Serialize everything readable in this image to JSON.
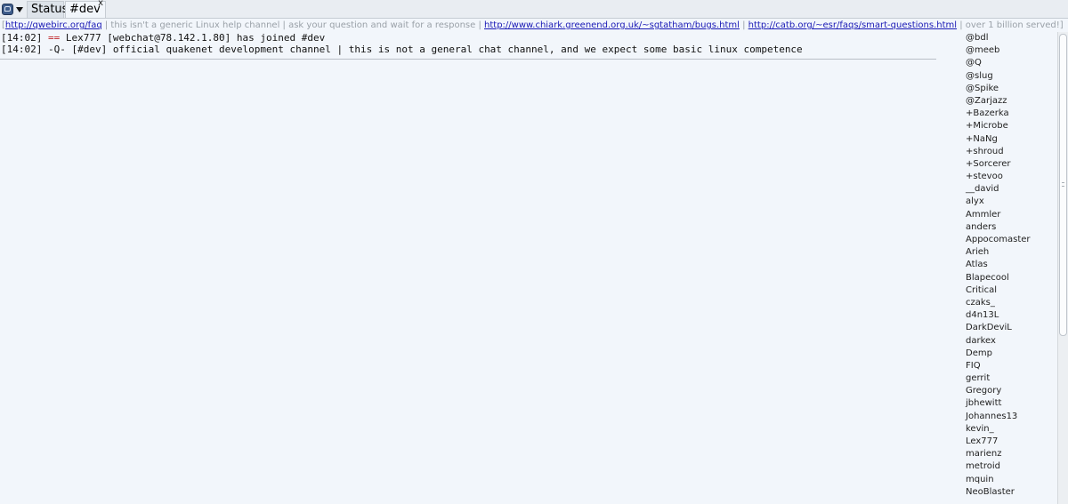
{
  "tabs": {
    "status_label": "Status",
    "channel_label": "#dev",
    "close_glyph": "x"
  },
  "topic": {
    "bracket_open": "[",
    "link1": "http://qwebirc.org/faq",
    "text1": " | this isn't a generic Linux help channel | ask your question and wait for a response | ",
    "link2": "http://www.chiark.greenend.org.uk/~sgtatham/bugs.html",
    "text2": " | ",
    "link3": "http://catb.org/~esr/faqs/smart-questions.html",
    "text3": "  | over 1 billion served!]"
  },
  "messages": [
    {
      "time": "[14:02]",
      "marker": "==",
      "text": "Lex777 [webchat@78.142.1.80] has joined #dev"
    },
    {
      "time": "[14:02]",
      "marker": "-Q-",
      "text": "[#dev] official quakenet development channel | this is not a general chat channel, and we expect some basic linux competence"
    }
  ],
  "nicks": [
    "@bdl",
    "@meeb",
    "@Q",
    "@slug",
    "@Spike",
    "@Zarjazz",
    "+Bazerka",
    "+Microbe",
    "+NaNg",
    "+shroud",
    "+Sorcerer",
    "+stevoo",
    "__david",
    "alyx",
    "Ammler",
    "anders",
    "Appocomaster",
    "Arieh",
    "Atlas",
    "Blapecool",
    "Critical",
    "czaks_",
    "d4n13L",
    "DarkDeviL",
    "darkex",
    "Demp",
    "FIQ",
    "gerrit",
    "Gregory",
    "jbhewitt",
    "Johannes13",
    "kevin_",
    "Lex777",
    "marienz",
    "metroid",
    "mquin",
    "NeoBlaster"
  ],
  "colors": {
    "join_marker": "#c0262a",
    "link": "#1a1ab6",
    "background": "#f2f6fb"
  }
}
